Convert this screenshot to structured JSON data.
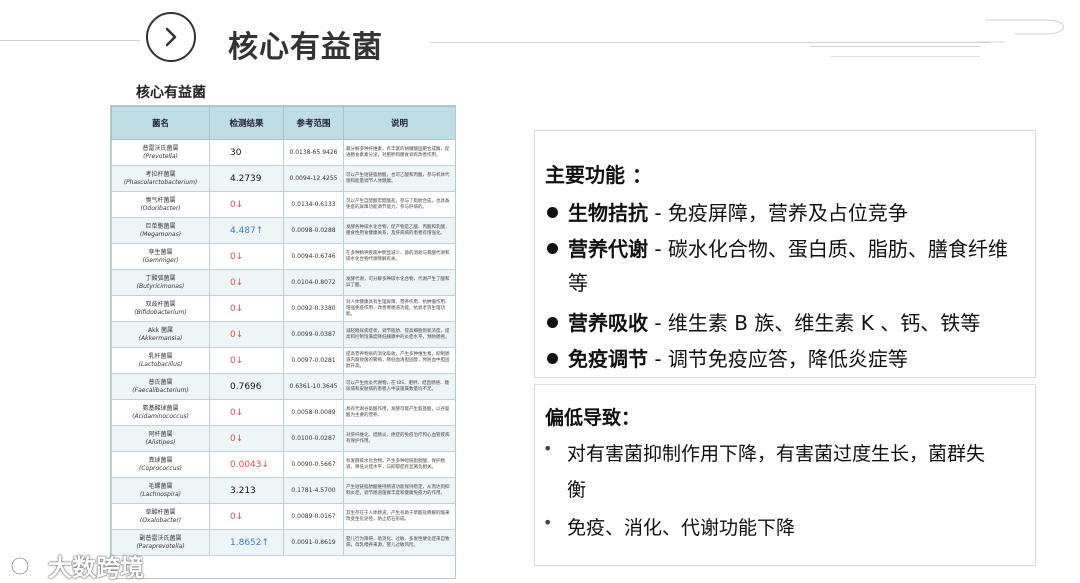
{
  "header": {
    "title": "核心有益菌"
  },
  "table": {
    "caption": "核心有益菌",
    "columns": [
      "菌名",
      "检测结果",
      "参考范围",
      "说明"
    ],
    "rows": [
      {
        "cn": "普雷沃氏菌属",
        "latin": "(Prevotella)",
        "result": "30",
        "dir": "",
        "ref": "0.0138-65.9426",
        "desc": "最分解多种纤维素，有丰富的胡腈酸固肥合成酶，促进膳食素素分泌，对肥胖和膳食调有改善作用。"
      },
      {
        "cn": "考拉杆菌属",
        "latin": "(Phascolarctobacterium)",
        "result": "4.2739",
        "dir": "",
        "ref": "0.0094-12.4255",
        "desc": "可以产生短链脂肪酸，也可乙酸和丙酸，参与机体代谢和能量调节人体健康。"
      },
      {
        "cn": "臭气杆菌属",
        "latin": "(Odoribacter)",
        "result": "0↓",
        "dir": "down",
        "ref": "0.0134-0.6133",
        "desc": "可以产生自醋酸宏醋酸盐，参与了脂肪合成，也具备免疫的屏障功能调节能力，参与肝病的。"
      },
      {
        "cn": "巨单胞菌属",
        "latin": "(Megamonas)",
        "result": "4.487↑",
        "dir": "up",
        "ref": "0.0098-0.0288",
        "desc": "发酵各种碳水化合物，促产物是乙酸、丙酸和乳酸，膳食性用食健康关系，及肝病病的患者有增强化。"
      },
      {
        "cn": "孪生菌属",
        "latin": "(Gemmiger)",
        "result": "0↓",
        "dir": "down",
        "ref": "0.0094-0.6746",
        "desc": "在多种精神疾病中明显减少，菌的消耗与氯酸代谢和碳水化合物代谢降解有关。"
      },
      {
        "cn": "丁酸弧菌属",
        "latin": "(Butyricimonas)",
        "result": "0↓",
        "dir": "down",
        "ref": "0.0104-0.8072",
        "desc": "发酵代谢，可分解多种碳水化合物，代谢产生丁酸和异丁酸。"
      },
      {
        "cn": "双歧杆菌属",
        "latin": "(Bifidobacterium)",
        "result": "0↓",
        "dir": "down",
        "ref": "0.0092-0.3380",
        "desc": "对人体健康具有生理屏障、营养作用、抗肿瘤作用、增强免疫作用、改善胃肠道功能、抗衰老等生理功能。"
      },
      {
        "cn": "Akk 菌属",
        "latin": "(Akkermansia)",
        "result": "0↓",
        "dir": "down",
        "ref": "0.0099-0.0387",
        "desc": "减轻糖尿病症状，调节脂肪、提高细胞饱氧浓度，提高和控制饱满度降低胰腺中的炎症水平，预防肠癌。"
      },
      {
        "cn": "乳杆菌属",
        "latin": "(Lactobacillus)",
        "result": "0↓",
        "dir": "down",
        "ref": "0.0097-0.0281",
        "desc": "提高营养物质的消化吸收，产生多种维生素，抑制肠道内腐败菌的繁殖，降低血清胆固醇，预防血中胆固醇升高。"
      },
      {
        "cn": "普氏菌属",
        "latin": "(Faecalibacterium)",
        "result": "0.7696",
        "dir": "",
        "ref": "0.6361-10.3645",
        "desc": "可以产生抗炎代谢物，在 IBS、肥胖、结直肠癌、糖尿病和皮肤病的患者人中该菌属数量均不足。"
      },
      {
        "cn": "氨基酸球菌属",
        "latin": "(Acidaminococcus)",
        "result": "0↓",
        "dir": "down",
        "ref": "0.0058-0.0089",
        "desc": "具有代谢谷氨酸作用，发酵可能产生氨基酸，以谷氨酸为主要的营养。"
      },
      {
        "cn": "阿杆菌属",
        "latin": "(Alistipes)",
        "result": "0↓",
        "dir": "down",
        "ref": "0.0100-0.0287",
        "desc": "对肝纤维化、结肠炎、癌症的免疫治疗和心血管疾病有保护作用。"
      },
      {
        "cn": "粪球菌属",
        "latin": "(Coprococcus)",
        "result": "0.0043↓",
        "dir": "down",
        "ref": "0.0090-0.5667",
        "desc": "有发酵碳水化合物，产生多种短链脂肪酸，保护肠道，降低炎症水平，与抑郁症有显著负相关。"
      },
      {
        "cn": "毛螺菌属",
        "latin": "(Lachnospira)",
        "result": "3.213",
        "dir": "",
        "ref": "0.1781-4.5700",
        "desc": "产生短链脂肪酸维持肠道功能保持稳定，从而达到抑制炎症，调节肠道菌群丰度和健康免疫力的作用。"
      },
      {
        "cn": "草酸杆菌属",
        "latin": "(Oxalobacter)",
        "result": "0↓",
        "dir": "down",
        "ref": "0.0089-0.0167",
        "desc": "其生存在于人体肠道，产生有助于草酸盐降解的酶来改变生化途径，防止结石形成。"
      },
      {
        "cn": "副普雷沃氏菌属",
        "latin": "(Paraprevotella)",
        "result": "1.8652↑",
        "dir": "up",
        "ref": "0.0091-0.8619",
        "desc": "婴儿行为障碍，助消化、过敏、多发性硬化症来自致病，母乳喂养来源，婴儿过敏风险。"
      }
    ]
  },
  "functions": {
    "title": "主要功能 ：",
    "items": [
      {
        "bold": "生物拮抗",
        "text": " - 免疫屏障，营养及占位竞争"
      },
      {
        "bold": "营养代谢",
        "text": " - 碳水化合物、蛋白质、脂肪、膳食纤维"
      },
      {
        "bold": "",
        "text": "等"
      },
      {
        "bold": "营养吸收",
        "text": " - 维生素 B 族、维生素 K 、钙、铁等"
      },
      {
        "bold": "免疫调节",
        "text": " - 调节免疫应答，降低炎症等"
      }
    ]
  },
  "low": {
    "title": "偏低导致：",
    "items": [
      {
        "text": "对有害菌抑制作用下降，有害菌过度生长，菌群失"
      },
      {
        "text": "衡"
      },
      {
        "text": "免疫、消化、代谢功能下降"
      }
    ]
  },
  "watermark": {
    "text": "大数跨境"
  }
}
